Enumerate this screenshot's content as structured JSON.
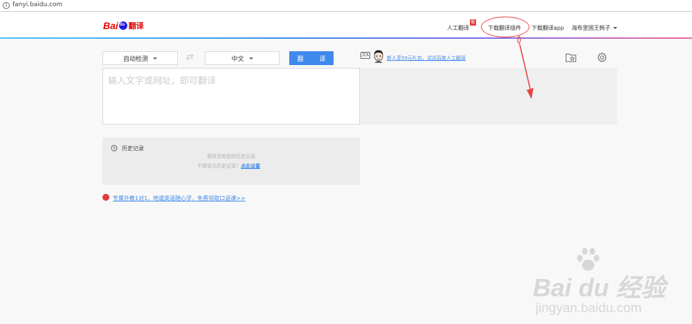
{
  "browser": {
    "url": "fanyi.baidu.com"
  },
  "header": {
    "logo": {
      "bai": "Bai",
      "du": "du",
      "translate": "翻译"
    },
    "nav": {
      "human_translate": "人工翻译",
      "new_badge": "新",
      "download_plugin": "下载翻译插件",
      "download_app": "下载翻译app",
      "user_name": "海布里国王韩子"
    }
  },
  "toolbar": {
    "source_lang": "自动检测",
    "target_lang": "中文",
    "translate_button": "翻 译",
    "promo_icon": "文A",
    "promo_text": "新人享50元礼包，试试百度人工翻译"
  },
  "input": {
    "placeholder": "输入文字或网址，即可翻译",
    "value": ""
  },
  "history": {
    "title": "历史记录",
    "empty_text": "暂时没有您的历史记录",
    "hint_prefix": "不想显示历史记录？",
    "hint_link": "点此设置"
  },
  "ad": {
    "text": "专属外教1对1，地道英语随心学，免费领取口语课>>"
  },
  "watermark": {
    "brand": "Bai du 经验",
    "sub": "jingyan.baidu.com"
  },
  "annotations": {
    "color": "#e84545"
  },
  "colors": {
    "accent": "#3f89ec",
    "brand_red": "#e10602",
    "brand_blue": "#2319dc"
  }
}
